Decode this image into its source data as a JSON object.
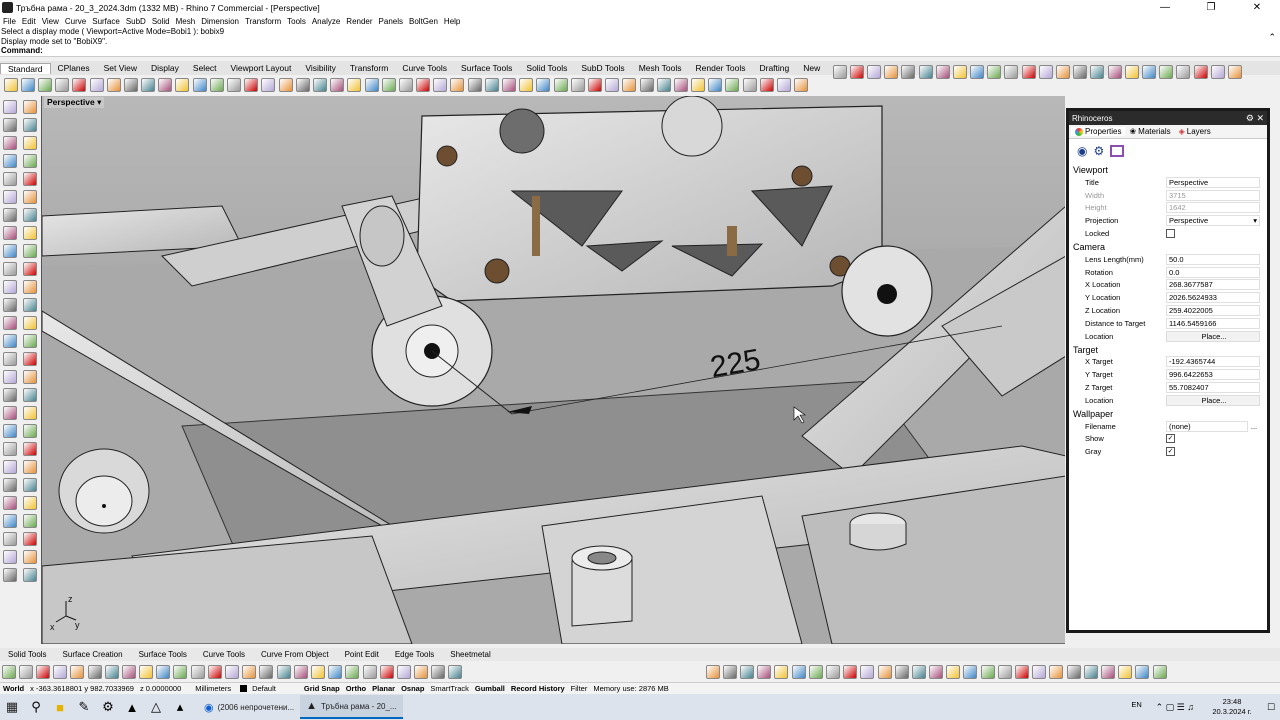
{
  "window": {
    "title": "Тръбна рама - 20_3_2024.3dm (1332 MB) - Rhino 7 Commercial - [Perspective]"
  },
  "menu": [
    "File",
    "Edit",
    "View",
    "Curve",
    "Surface",
    "SubD",
    "Solid",
    "Mesh",
    "Dimension",
    "Transform",
    "Tools",
    "Analyze",
    "Render",
    "Panels",
    "BoltGen",
    "Help"
  ],
  "command_history": {
    "line1": "Select a display mode ( Viewport=Active  Mode=Bobi1 ): bobix9",
    "line2": "Display mode set to \"BobiX9\".",
    "prompt": "Command:"
  },
  "toolbar_tabs": [
    "Standard",
    "CPlanes",
    "Set View",
    "Display",
    "Select",
    "Viewport Layout",
    "Visibility",
    "Transform",
    "Curve Tools",
    "Surface Tools",
    "Solid Tools",
    "SubD Tools",
    "Mesh Tools",
    "Render Tools",
    "Drafting",
    "New"
  ],
  "viewport": {
    "name": "Perspective",
    "dimension_text": "225",
    "axis_x": "x",
    "axis_y": "y",
    "axis_z": "z"
  },
  "panel": {
    "title": "Rhinoceros",
    "tabs": [
      "Properties",
      "Materials",
      "Layers"
    ],
    "viewport_section": "Viewport",
    "viewport_rows": [
      {
        "label": "Title",
        "value": "Perspective"
      },
      {
        "label": "Width",
        "value": "3715"
      },
      {
        "label": "Height",
        "value": "1642"
      },
      {
        "label": "Projection",
        "value": "Perspective"
      }
    ],
    "locked_label": "Locked",
    "camera_section": "Camera",
    "camera_rows": [
      {
        "label": "Lens Length(mm)",
        "value": "50.0"
      },
      {
        "label": "Rotation",
        "value": "0.0"
      },
      {
        "label": "X Location",
        "value": "268.3677587"
      },
      {
        "label": "Y Location",
        "value": "2026.5624933"
      },
      {
        "label": "Z Location",
        "value": "259.4022005"
      },
      {
        "label": "Distance to Target",
        "value": "1146.5459166"
      }
    ],
    "camera_location_label": "Location",
    "place_button": "Place...",
    "target_section": "Target",
    "target_rows": [
      {
        "label": "X Target",
        "value": "-192.4365744"
      },
      {
        "label": "Y Target",
        "value": "996.6422653"
      },
      {
        "label": "Z Target",
        "value": "55.7082407"
      }
    ],
    "target_location_label": "Location",
    "wallpaper_section": "Wallpaper",
    "filename_label": "Filename",
    "filename_value": "(none)",
    "show_label": "Show",
    "gray_label": "Gray"
  },
  "bottom_tabs": [
    "Solid Tools",
    "Surface Creation",
    "Surface Tools",
    "Curve Tools",
    "Curve From Object",
    "Point Edit",
    "Edge Tools",
    "Sheetmetal"
  ],
  "status": {
    "cplane": "World",
    "coords": "x -363.3618801  y 982.7033969",
    "z": "z 0.0000000",
    "units": "Millimeters",
    "layer": "Default",
    "grid_snap": "Grid Snap",
    "ortho": "Ortho",
    "planar": "Planar",
    "osnap": "Osnap",
    "smarttrack": "SmartTrack",
    "gumball": "Gumball",
    "record_history": "Record History",
    "filter": "Filter",
    "memory": "Memory use: 2876 MB"
  },
  "taskbar": {
    "app1": "(2006 непрочетени...",
    "app2": "Тръбна рама - 20_...",
    "lang": "EN",
    "time": "23:48",
    "date": "20.3.2024 г."
  },
  "colors": {
    "accent": "#0067c0",
    "viewport_bg": "#9d9d9d",
    "panel_border": "#1a1a1a"
  }
}
